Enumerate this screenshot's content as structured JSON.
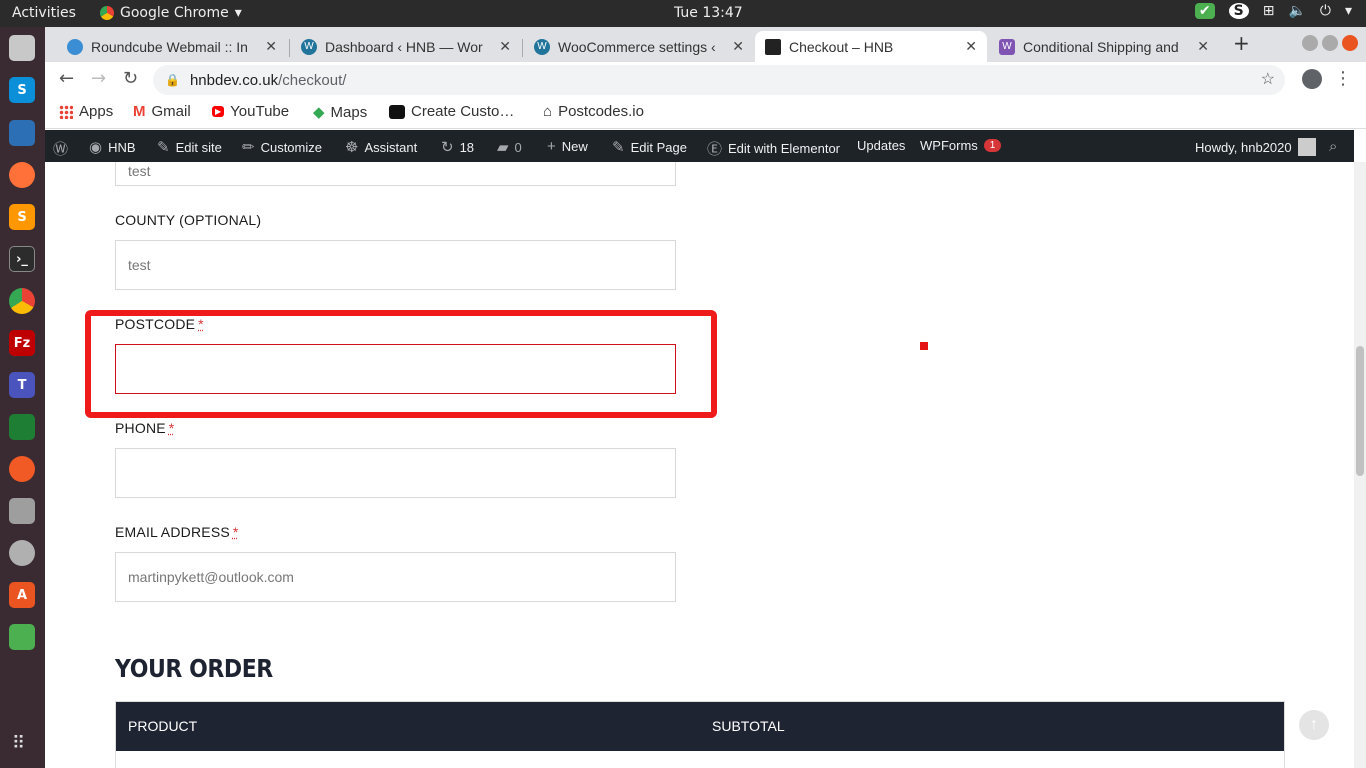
{
  "system": {
    "activities": "Activities",
    "app_name": "Google Chrome",
    "clock": "Tue 13:47"
  },
  "tabs": [
    {
      "title": "Roundcube Webmail :: In",
      "active": false
    },
    {
      "title": "Dashboard ‹ HNB — Wor",
      "active": false
    },
    {
      "title": "WooCommerce settings ‹",
      "active": false
    },
    {
      "title": "Checkout – HNB",
      "active": true
    },
    {
      "title": "Conditional Shipping and",
      "active": false
    }
  ],
  "address": {
    "host": "hnbdev.co.uk",
    "path": "/checkout/"
  },
  "bookmarks": [
    "Apps",
    "Gmail",
    "YouTube",
    "Maps",
    "Create Custo…",
    "Postcodes.io"
  ],
  "adminbar": {
    "site": "HNB",
    "edit_site": "Edit site",
    "customize": "Customize",
    "assistant": "Assistant",
    "updates_count": "18",
    "comments_count": "0",
    "new": "New",
    "edit_page": "Edit Page",
    "elementor": "Edit with Elementor",
    "updates": "Updates",
    "wpforms": "WPForms",
    "wpforms_badge": "1",
    "howdy": "Howdy, hnb2020"
  },
  "form": {
    "top_value": "test",
    "county_label": "COUNTY (OPTIONAL)",
    "county_value": "test",
    "postcode_label": "POSTCODE",
    "postcode_value": "",
    "phone_label": "PHONE",
    "phone_value": "",
    "email_label": "EMAIL ADDRESS",
    "email_value": "martinpykett@outlook.com",
    "required_mark": "*"
  },
  "order": {
    "title": "YOUR ORDER",
    "col_product": "PRODUCT",
    "col_subtotal": "SUBTOTAL"
  }
}
